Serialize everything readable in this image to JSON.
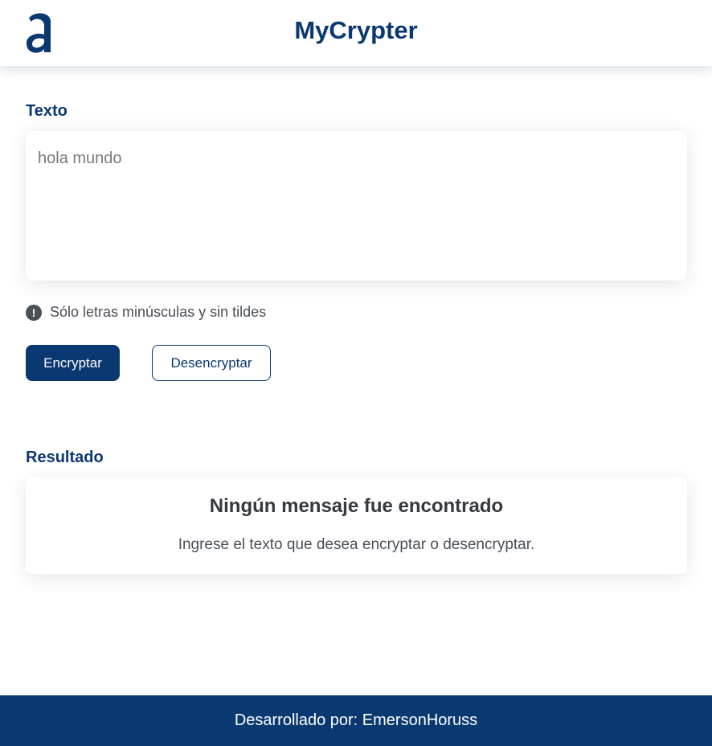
{
  "colors": {
    "primary": "#0a3871",
    "background": "#ffffff",
    "muted_text": "#495057",
    "heading_text": "#343a40"
  },
  "header": {
    "logo_icon": "alura-logo-icon",
    "title": "MyCrypter"
  },
  "input_section": {
    "label": "Texto",
    "placeholder": "hola mundo",
    "value": "",
    "warning_icon": "exclamation-circle-icon",
    "warning_text": "Sólo letras minúsculas y sin tildes"
  },
  "actions": {
    "encrypt_label": "Encryptar",
    "decrypt_label": "Desencryptar"
  },
  "result_section": {
    "label": "Resultado",
    "title": "Ningún mensaje fue encontrado",
    "subtitle": "Ingrese el texto que desea encryptar o desencryptar."
  },
  "footer": {
    "text": "Desarrollado por: EmersonHoruss"
  }
}
